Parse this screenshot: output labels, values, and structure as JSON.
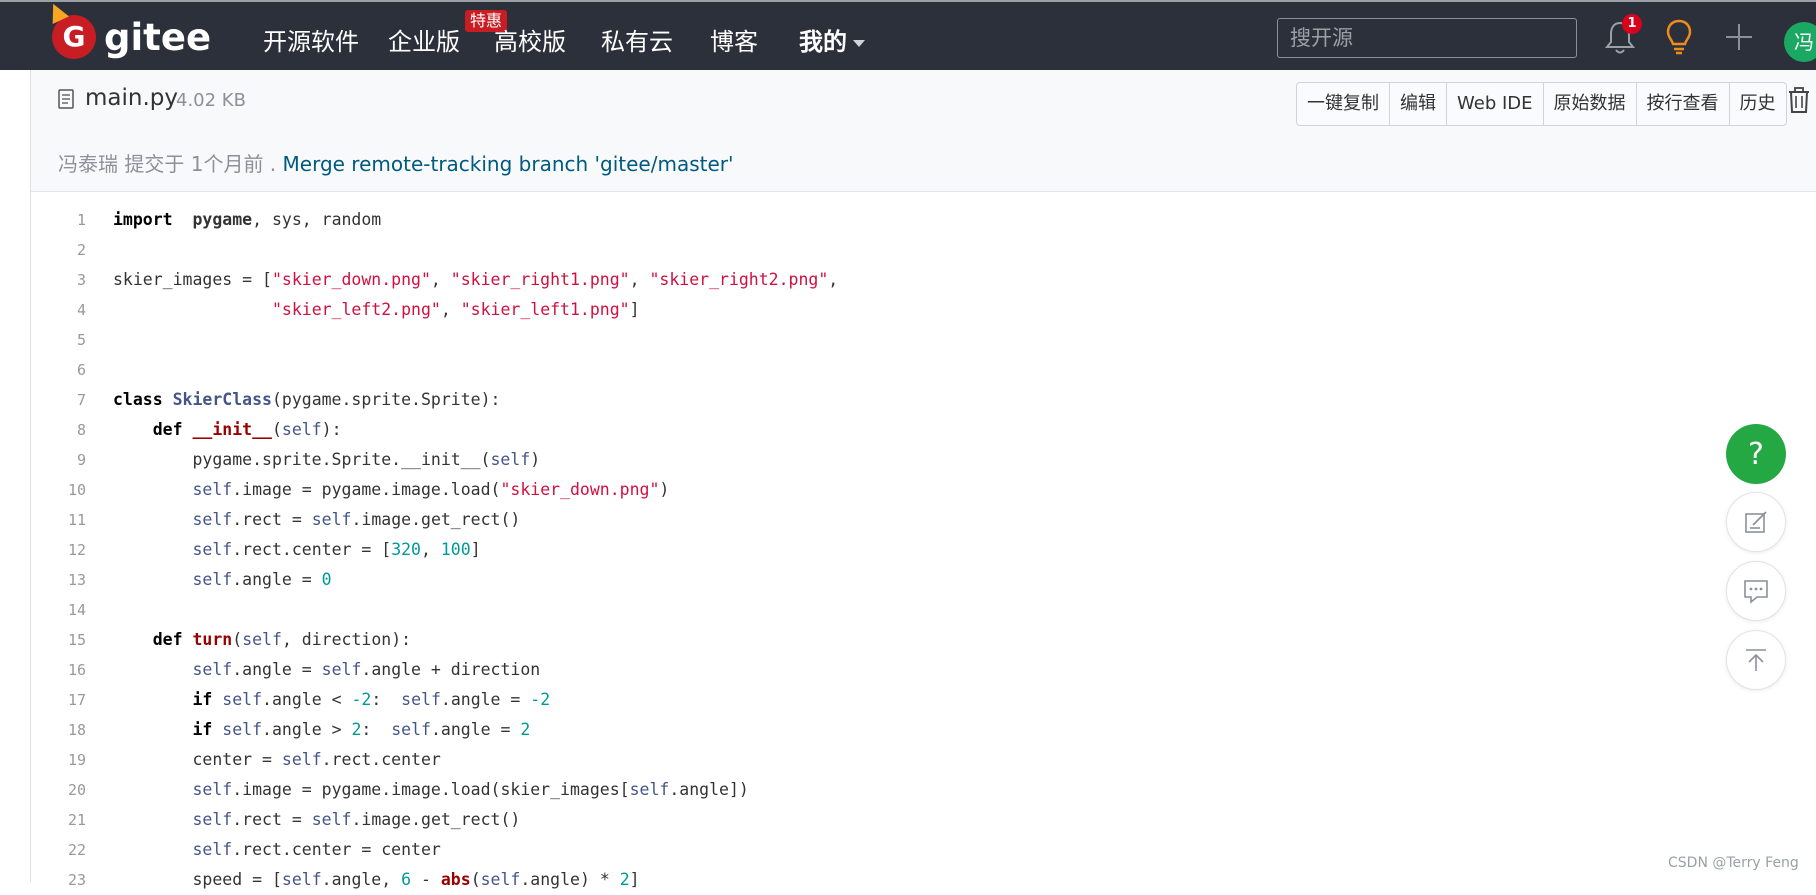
{
  "nav": {
    "brand": "gitee",
    "items": [
      "开源软件",
      "企业版",
      "高校版",
      "私有云",
      "博客",
      "我的"
    ],
    "promo_badge": "特惠",
    "search_placeholder": "搜开源",
    "notification_count": "1",
    "avatar_initial": "冯"
  },
  "file": {
    "name": "main.py",
    "size": "4.02 KB",
    "buttons": [
      "一键复制",
      "编辑",
      "Web IDE",
      "原始数据",
      "按行查看",
      "历史"
    ],
    "commit_author_time": "冯泰瑞 提交于 1个月前 .",
    "commit_message": "Merge remote-tracking branch 'gitee/master'"
  },
  "code_lines": [
    {
      "n": "1",
      "segs": [
        [
          "kw",
          "import"
        ],
        [
          "",
          "  "
        ],
        [
          "bold",
          "pygame"
        ],
        [
          "",
          ", sys, random"
        ]
      ]
    },
    {
      "n": "2",
      "segs": []
    },
    {
      "n": "3",
      "segs": [
        [
          "",
          "skier_images = ["
        ],
        [
          "str",
          "\"skier_down.png\""
        ],
        [
          "",
          ", "
        ],
        [
          "str",
          "\"skier_right1.png\""
        ],
        [
          "",
          ", "
        ],
        [
          "str",
          "\"skier_right2.png\""
        ],
        [
          "",
          ","
        ]
      ]
    },
    {
      "n": "4",
      "segs": [
        [
          "",
          "                "
        ],
        [
          "str",
          "\"skier_left2.png\""
        ],
        [
          "",
          ", "
        ],
        [
          "str",
          "\"skier_left1.png\""
        ],
        [
          "",
          "]"
        ]
      ]
    },
    {
      "n": "5",
      "segs": []
    },
    {
      "n": "6",
      "segs": []
    },
    {
      "n": "7",
      "segs": [
        [
          "kw",
          "class"
        ],
        [
          "",
          " "
        ],
        [
          "cls",
          "SkierClass"
        ],
        [
          "",
          "(pygame.sprite.Sprite):"
        ]
      ]
    },
    {
      "n": "8",
      "segs": [
        [
          "",
          "    "
        ],
        [
          "kw",
          "def"
        ],
        [
          "",
          " "
        ],
        [
          "fn",
          "__init__"
        ],
        [
          "",
          "("
        ],
        [
          "slf",
          "self"
        ],
        [
          "",
          "):"
        ]
      ]
    },
    {
      "n": "9",
      "segs": [
        [
          "",
          "        pygame.sprite.Sprite.__init__("
        ],
        [
          "slf",
          "self"
        ],
        [
          "",
          ")"
        ]
      ]
    },
    {
      "n": "10",
      "segs": [
        [
          "",
          "        "
        ],
        [
          "slf",
          "self"
        ],
        [
          "",
          ".image = pygame.image.load("
        ],
        [
          "str",
          "\"skier_down.png\""
        ],
        [
          "",
          ")"
        ]
      ]
    },
    {
      "n": "11",
      "segs": [
        [
          "",
          "        "
        ],
        [
          "slf",
          "self"
        ],
        [
          "",
          ".rect = "
        ],
        [
          "slf",
          "self"
        ],
        [
          "",
          ".image.get_rect()"
        ]
      ]
    },
    {
      "n": "12",
      "segs": [
        [
          "",
          "        "
        ],
        [
          "slf",
          "self"
        ],
        [
          "",
          ".rect.center = ["
        ],
        [
          "num",
          "320"
        ],
        [
          "",
          ", "
        ],
        [
          "num",
          "100"
        ],
        [
          "",
          "]"
        ]
      ]
    },
    {
      "n": "13",
      "segs": [
        [
          "",
          "        "
        ],
        [
          "slf",
          "self"
        ],
        [
          "",
          ".angle = "
        ],
        [
          "num",
          "0"
        ]
      ]
    },
    {
      "n": "14",
      "segs": []
    },
    {
      "n": "15",
      "segs": [
        [
          "",
          "    "
        ],
        [
          "kw",
          "def"
        ],
        [
          "",
          " "
        ],
        [
          "fn",
          "turn"
        ],
        [
          "",
          "("
        ],
        [
          "slf",
          "self"
        ],
        [
          "",
          ", direction):"
        ]
      ]
    },
    {
      "n": "16",
      "segs": [
        [
          "",
          "        "
        ],
        [
          "slf",
          "self"
        ],
        [
          "",
          ".angle = "
        ],
        [
          "slf",
          "self"
        ],
        [
          "",
          ".angle + direction"
        ]
      ]
    },
    {
      "n": "17",
      "segs": [
        [
          "",
          "        "
        ],
        [
          "kw",
          "if"
        ],
        [
          "",
          " "
        ],
        [
          "slf",
          "self"
        ],
        [
          "",
          ".angle < "
        ],
        [
          "num",
          "-2"
        ],
        [
          "",
          ":  "
        ],
        [
          "slf",
          "self"
        ],
        [
          "",
          ".angle = "
        ],
        [
          "num",
          "-2"
        ]
      ]
    },
    {
      "n": "18",
      "segs": [
        [
          "",
          "        "
        ],
        [
          "kw",
          "if"
        ],
        [
          "",
          " "
        ],
        [
          "slf",
          "self"
        ],
        [
          "",
          ".angle > "
        ],
        [
          "num",
          "2"
        ],
        [
          "",
          ":  "
        ],
        [
          "slf",
          "self"
        ],
        [
          "",
          ".angle = "
        ],
        [
          "num",
          "2"
        ]
      ]
    },
    {
      "n": "19",
      "segs": [
        [
          "",
          "        center = "
        ],
        [
          "slf",
          "self"
        ],
        [
          "",
          ".rect.center"
        ]
      ]
    },
    {
      "n": "20",
      "segs": [
        [
          "",
          "        "
        ],
        [
          "slf",
          "self"
        ],
        [
          "",
          ".image = pygame.image.load(skier_images["
        ],
        [
          "slf",
          "self"
        ],
        [
          "",
          ".angle])"
        ]
      ]
    },
    {
      "n": "21",
      "segs": [
        [
          "",
          "        "
        ],
        [
          "slf",
          "self"
        ],
        [
          "",
          ".rect = "
        ],
        [
          "slf",
          "self"
        ],
        [
          "",
          ".image.get_rect()"
        ]
      ]
    },
    {
      "n": "22",
      "segs": [
        [
          "",
          "        "
        ],
        [
          "slf",
          "self"
        ],
        [
          "",
          ".rect.center = center"
        ]
      ]
    },
    {
      "n": "23",
      "segs": [
        [
          "",
          "        speed = ["
        ],
        [
          "slf",
          "self"
        ],
        [
          "",
          ".angle, "
        ],
        [
          "num",
          "6"
        ],
        [
          "",
          " - "
        ],
        [
          "fn",
          "abs"
        ],
        [
          "",
          "("
        ],
        [
          "slf",
          "self"
        ],
        [
          "",
          ".angle) * "
        ],
        [
          "num",
          "2"
        ],
        [
          "",
          "]"
        ]
      ]
    }
  ],
  "floating": {
    "help_label": "?"
  },
  "watermark": "CSDN @Terry Feng",
  "colors": {
    "nav_bg": "#2b303b",
    "brand_red": "#c71d23",
    "help_green": "#24a844",
    "link_blue": "#005980"
  },
  "icons": [
    "gitee-logo-icon",
    "bell-icon",
    "bulb-icon",
    "plus-icon",
    "file-icon",
    "trash-icon",
    "feedback-edit-icon",
    "chat-icon",
    "back-to-top-icon"
  ]
}
